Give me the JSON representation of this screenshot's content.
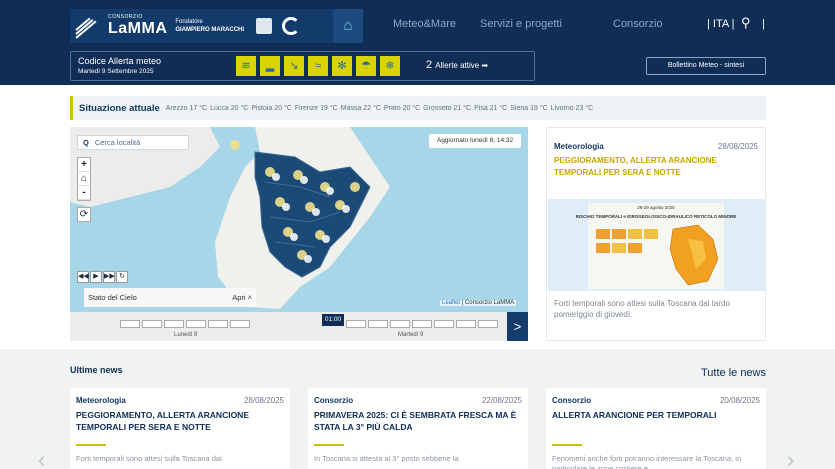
{
  "header": {
    "logo": {
      "small": "CONSORZIO",
      "big": "LaMMA",
      "founder_label": "Fondatore",
      "founder_name": "GIAMPIERO MARACCHI"
    },
    "nav": [
      "Meteo&Mare",
      "Servizi e progetti",
      "Consorzio"
    ],
    "lang": "| ITA |",
    "pipe": "|"
  },
  "alert": {
    "title": "Codice Allerta meteo",
    "date": "Martedì 9 Settembre 2025",
    "icons": [
      "wind-icon",
      "flood-icon",
      "hydro-icon",
      "storm-surge-icon",
      "snow-icon",
      "thunderstorm-icon",
      "ice-icon"
    ],
    "count": "2",
    "count_label": "Allerte attive ➡",
    "bollettino": "Bollettino Meteo - sintesi"
  },
  "situazione": {
    "label": "Situazione attuale",
    "items": [
      "Arezzo 17 °C",
      "Lucca 20 °C",
      "Pistoia 20 °C",
      "Firenze 19 °C",
      "Massa 22 °C",
      "Prato 20 °C",
      "Grosseto 21 °C",
      "Pisa 21 °C",
      "Siena 19 °C",
      "Livorno 23 °C"
    ]
  },
  "map": {
    "search_placeholder": "Cerca località",
    "updated": "Aggiornato lunedì 8, 14:32",
    "layer": "Stato del Cielo",
    "layer_toggle": "Apri ˄",
    "attribution_link": "Leaflet",
    "attribution_text": " | Consorzio LaMMA",
    "now": "01:00",
    "day1": "Lunedì 8",
    "day2": "Martedì 9"
  },
  "featured": {
    "category": "Meteorologia",
    "date": "28/08/2025",
    "title": "PEGGIORAMENTO, ALLERTA ARANCIONE TEMPORALI PER SERA E NOTTE",
    "image_heading": "28-29 agosto 2025",
    "image_title": "RISCHIO TEMPORALI e IDROGEOLOGICO-IDRAULICO RETICOLO MINORE",
    "excerpt": "Forti temporali sono attesi sulla Toscana dal tardo pomeriggio di giovedì."
  },
  "news": {
    "heading": "Ultime news",
    "all_link": "Tutte le news",
    "cards": [
      {
        "category": "Meteorologia",
        "date": "28/08/2025",
        "title": "PEGGIORAMENTO, ALLERTA ARANCIONE TEMPORALI PER SERA E NOTTE",
        "excerpt": "Forti temporali sono attesi sulla Toscana dal"
      },
      {
        "category": "Consorzio",
        "date": "22/08/2025",
        "title": "PRIMAVERA 2025: CI È SEMBRATA FRESCA MA È STATA LA 3° PIÙ CALDA",
        "excerpt": "In Toscana si attesta al 3° posto sebbene la"
      },
      {
        "category": "Consorzio",
        "date": "20/08/2025",
        "title": "ALLERTA ARANCIONE PER TEMPORALI",
        "excerpt": "Fenomeni anche forti potranno interessare la Toscana, in particolare le zone costiere e"
      }
    ]
  },
  "colors": {
    "navy": "#0f2d55",
    "accent": "#c9c300",
    "gold": "#c8a500"
  }
}
